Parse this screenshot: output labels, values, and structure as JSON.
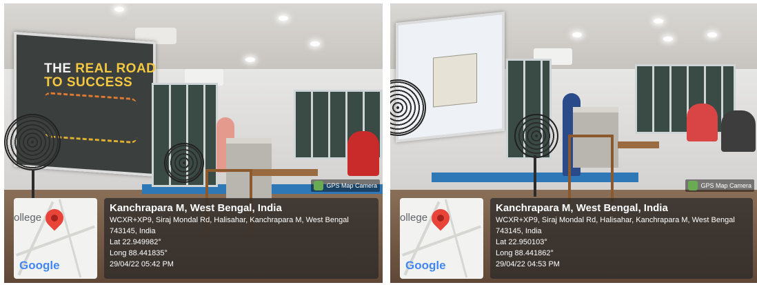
{
  "photos": [
    {
      "screen_title_line1_a": "THE ",
      "screen_title_line1_b": "REAL ROAD",
      "screen_title_line2": "TO SUCCESS",
      "gps_badge": "GPS Map Camera",
      "map_label": "ollege",
      "map_logo": "Google",
      "location_title": "Kanchrapara M, West Bengal, India",
      "address_line1": "WCXR+XP9, Siraj Mondal Rd, Halisahar, Kanchrapara M, West Bengal",
      "address_line2": "743145, India",
      "latitude": "Lat 22.949982°",
      "longitude": "Long 88.441835°",
      "timestamp": "29/04/22 05:42 PM"
    },
    {
      "gps_badge": "GPS Map Camera",
      "map_label": "ollege",
      "map_logo": "Google",
      "location_title": "Kanchrapara M, West Bengal, India",
      "address_line1": "WCXR+XP9, Siraj Mondal Rd, Halisahar, Kanchrapara M, West Bengal",
      "address_line2": "743145, India",
      "latitude": "Lat 22.950103°",
      "longitude": "Long 88.441862°",
      "timestamp": "29/04/22 04:53 PM"
    }
  ],
  "icons": [
    "map-pin-icon",
    "gps-camera-icon"
  ],
  "colors": {
    "map_pin": "#e8443a",
    "overlay": "#282828",
    "wall_stripe": "#2f78b7"
  }
}
